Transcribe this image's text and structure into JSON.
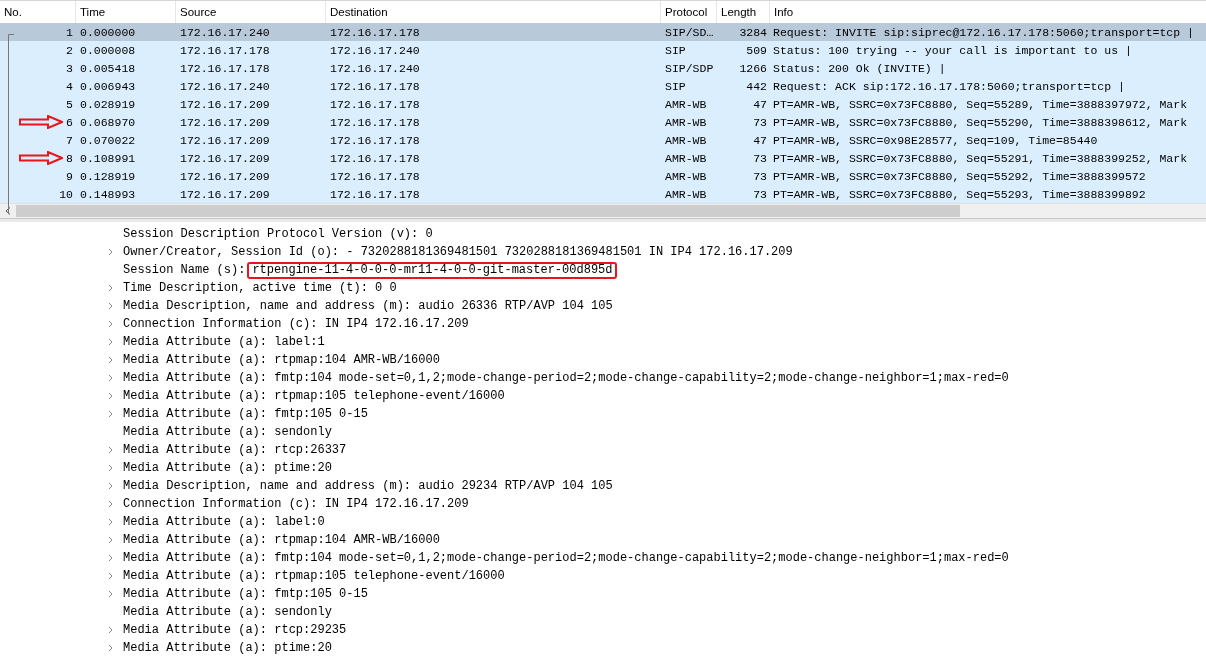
{
  "packet_list": {
    "columns": [
      "No.",
      "Time",
      "Source",
      "Destination",
      "Protocol",
      "Length",
      "Info"
    ],
    "rows": [
      {
        "cells": [
          "1",
          "0.000000",
          "172.16.17.240",
          "172.16.17.178",
          "SIP/SD…",
          "3284",
          "Request: INVITE sip:siprec@172.16.17.178:5060;transport=tcp |"
        ],
        "selected": true,
        "marked": false
      },
      {
        "cells": [
          "2",
          "0.000008",
          "172.16.17.178",
          "172.16.17.240",
          "SIP",
          "509",
          "Status: 100 trying -- your call is important to us |"
        ],
        "selected": false,
        "marked": false
      },
      {
        "cells": [
          "3",
          "0.005418",
          "172.16.17.178",
          "172.16.17.240",
          "SIP/SDP",
          "1266",
          "Status: 200 Ok (INVITE) |"
        ],
        "selected": false,
        "marked": false
      },
      {
        "cells": [
          "4",
          "0.006943",
          "172.16.17.240",
          "172.16.17.178",
          "SIP",
          "442",
          "Request: ACK sip:172.16.17.178:5060;transport=tcp |"
        ],
        "selected": false,
        "marked": false
      },
      {
        "cells": [
          "5",
          "0.028919",
          "172.16.17.209",
          "172.16.17.178",
          "AMR-WB",
          "47",
          "PT=AMR-WB, SSRC=0x73FC8880, Seq=55289, Time=3888397972, Mark"
        ],
        "selected": false,
        "marked": false
      },
      {
        "cells": [
          "6",
          "0.068970",
          "172.16.17.209",
          "172.16.17.178",
          "AMR-WB",
          "73",
          "PT=AMR-WB, SSRC=0x73FC8880, Seq=55290, Time=3888398612, Mark"
        ],
        "selected": false,
        "marked": true
      },
      {
        "cells": [
          "7",
          "0.070022",
          "172.16.17.209",
          "172.16.17.178",
          "AMR-WB",
          "47",
          "PT=AMR-WB, SSRC=0x98E28577, Seq=109, Time=85440"
        ],
        "selected": false,
        "marked": false
      },
      {
        "cells": [
          "8",
          "0.108991",
          "172.16.17.209",
          "172.16.17.178",
          "AMR-WB",
          "73",
          "PT=AMR-WB, SSRC=0x73FC8880, Seq=55291, Time=3888399252, Mark"
        ],
        "selected": false,
        "marked": true
      },
      {
        "cells": [
          "9",
          "0.128919",
          "172.16.17.209",
          "172.16.17.178",
          "AMR-WB",
          "73",
          "PT=AMR-WB, SSRC=0x73FC8880, Seq=55292, Time=3888399572"
        ],
        "selected": false,
        "marked": false
      },
      {
        "cells": [
          "10",
          "0.148993",
          "172.16.17.209",
          "172.16.17.178",
          "AMR-WB",
          "73",
          "PT=AMR-WB, SSRC=0x73FC8880, Seq=55293, Time=3888399892"
        ],
        "selected": false,
        "marked": false
      }
    ]
  },
  "details": [
    {
      "text": "Session Description Protocol Version (v): 0",
      "expandable": false
    },
    {
      "text": "Owner/Creator, Session Id (o): - 7320288181369481501 7320288181369481501 IN IP4 172.16.17.209",
      "expandable": true
    },
    {
      "text": "Session Name (s):",
      "boxed_value": "rtpengine-11-4-0-0-0-mr11-4-0-0-git-master-00d895d",
      "expandable": false
    },
    {
      "text": "Time Description, active time (t): 0 0",
      "expandable": true
    },
    {
      "text": "Media Description, name and address (m): audio 26336 RTP/AVP 104 105",
      "expandable": true
    },
    {
      "text": "Connection Information (c): IN IP4 172.16.17.209",
      "expandable": true
    },
    {
      "text": "Media Attribute (a): label:1",
      "expandable": true
    },
    {
      "text": "Media Attribute (a): rtpmap:104 AMR-WB/16000",
      "expandable": true
    },
    {
      "text": "Media Attribute (a): fmtp:104 mode-set=0,1,2;mode-change-period=2;mode-change-capability=2;mode-change-neighbor=1;max-red=0",
      "expandable": true
    },
    {
      "text": "Media Attribute (a): rtpmap:105 telephone-event/16000",
      "expandable": true
    },
    {
      "text": "Media Attribute (a): fmtp:105 0-15",
      "expandable": true
    },
    {
      "text": "Media Attribute (a): sendonly",
      "expandable": false
    },
    {
      "text": "Media Attribute (a): rtcp:26337",
      "expandable": true
    },
    {
      "text": "Media Attribute (a): ptime:20",
      "expandable": true
    },
    {
      "text": "Media Description, name and address (m): audio 29234 RTP/AVP 104 105",
      "expandable": true
    },
    {
      "text": "Connection Information (c): IN IP4 172.16.17.209",
      "expandable": true
    },
    {
      "text": "Media Attribute (a): label:0",
      "expandable": true
    },
    {
      "text": "Media Attribute (a): rtpmap:104 AMR-WB/16000",
      "expandable": true
    },
    {
      "text": "Media Attribute (a): fmtp:104 mode-set=0,1,2;mode-change-period=2;mode-change-capability=2;mode-change-neighbor=1;max-red=0",
      "expandable": true
    },
    {
      "text": "Media Attribute (a): rtpmap:105 telephone-event/16000",
      "expandable": true
    },
    {
      "text": "Media Attribute (a): fmtp:105 0-15",
      "expandable": true
    },
    {
      "text": "Media Attribute (a): sendonly",
      "expandable": false
    },
    {
      "text": "Media Attribute (a): rtcp:29235",
      "expandable": true
    },
    {
      "text": "Media Attribute (a): ptime:20",
      "expandable": true
    }
  ]
}
